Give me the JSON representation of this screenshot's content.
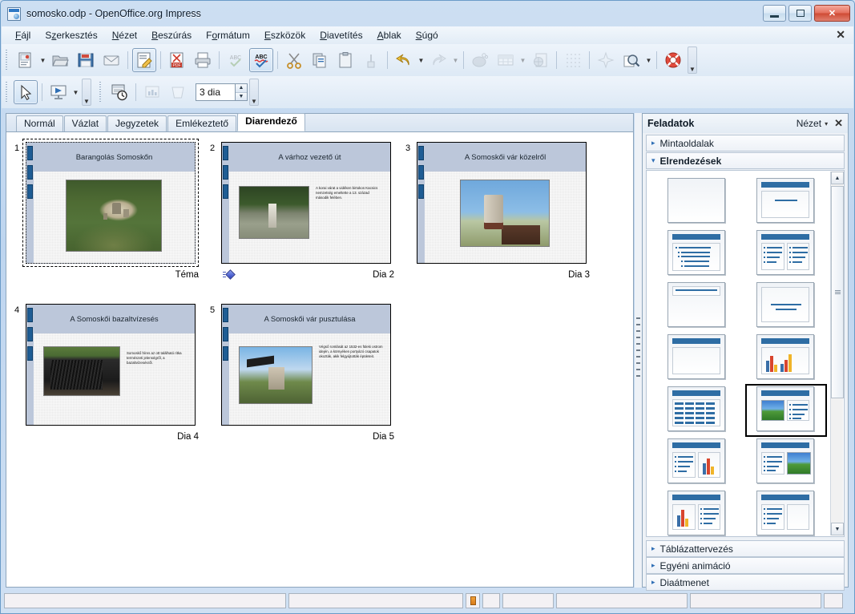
{
  "window": {
    "title": "somosko.odp - OpenOffice.org Impress",
    "app_icon": "impress-icon",
    "minimize_label": "Minimize",
    "maximize_label": "Maximize",
    "close_label": "✕"
  },
  "menubar": {
    "items": [
      {
        "label": "Fájl",
        "mnemonic": "F"
      },
      {
        "label": "Szerkesztés",
        "mnemonic": "z"
      },
      {
        "label": "Nézet",
        "mnemonic": "N"
      },
      {
        "label": "Beszúrás",
        "mnemonic": "B"
      },
      {
        "label": "Formátum",
        "mnemonic": "o"
      },
      {
        "label": "Eszközök",
        "mnemonic": "E"
      },
      {
        "label": "Diavetítés",
        "mnemonic": "D"
      },
      {
        "label": "Ablak",
        "mnemonic": "A"
      },
      {
        "label": "Súgó",
        "mnemonic": "S"
      }
    ],
    "close_document_label": "✕"
  },
  "toolbar_standard": {
    "buttons": [
      {
        "name": "new-document",
        "icon": "new-doc-icon",
        "enabled": true,
        "has_dropdown": true
      },
      {
        "name": "open-document",
        "icon": "open-folder-icon",
        "enabled": true
      },
      {
        "name": "save-document",
        "icon": "save-disk-icon",
        "enabled": true
      },
      {
        "name": "send-email",
        "icon": "envelope-icon",
        "enabled": true
      },
      {
        "name": "edit-file",
        "icon": "edit-pencil-icon",
        "enabled": true,
        "pressed": true
      },
      {
        "name": "export-pdf",
        "icon": "pdf-icon",
        "enabled": true
      },
      {
        "name": "print-file",
        "icon": "printer-icon",
        "enabled": true
      },
      {
        "name": "spellcheck",
        "icon": "abc-check-icon",
        "enabled": false
      },
      {
        "name": "autospellcheck",
        "icon": "abc-wave-icon",
        "enabled": true,
        "pressed": true
      },
      {
        "name": "cut",
        "icon": "scissors-icon",
        "enabled": true
      },
      {
        "name": "copy",
        "icon": "copy-icon",
        "enabled": true
      },
      {
        "name": "paste",
        "icon": "clipboard-icon",
        "enabled": true
      },
      {
        "name": "clone-formatting",
        "icon": "paintbrush-icon",
        "enabled": false
      },
      {
        "name": "undo",
        "icon": "undo-arrow-icon",
        "enabled": true,
        "has_dropdown": true
      },
      {
        "name": "redo",
        "icon": "redo-arrow-icon",
        "enabled": false,
        "has_dropdown": true
      },
      {
        "name": "chart",
        "icon": "chart-pie-icon",
        "enabled": false
      },
      {
        "name": "table",
        "icon": "table-grid-icon",
        "enabled": false,
        "has_dropdown": true
      },
      {
        "name": "hyperlink",
        "icon": "globe-page-icon",
        "enabled": false
      },
      {
        "name": "display-grid",
        "icon": "grid-dots-icon",
        "enabled": false
      },
      {
        "name": "show-draw-functions",
        "icon": "star-shape-icon",
        "enabled": false
      },
      {
        "name": "zoom",
        "icon": "magnifier-icon",
        "enabled": true,
        "has_dropdown": true
      },
      {
        "name": "help",
        "icon": "lifebuoy-help-icon",
        "enabled": true
      }
    ]
  },
  "toolbar_slideview": {
    "buttons": [
      {
        "name": "select-tool",
        "icon": "cursor-arrow-icon",
        "enabled": true,
        "pressed": true
      },
      {
        "name": "start-slideshow",
        "icon": "presentation-screen-icon",
        "enabled": true,
        "has_dropdown": true
      },
      {
        "name": "rehearse-timings",
        "icon": "clock-presentation-icon",
        "enabled": true
      },
      {
        "name": "show-slide",
        "icon": "show-slide-icon",
        "enabled": false
      },
      {
        "name": "hide-slide",
        "icon": "hide-slide-icon",
        "enabled": false
      }
    ],
    "slides_per_row": {
      "label": "3 dia",
      "value": "3 dia",
      "name": "slides-per-row-spinner"
    }
  },
  "view_tabs": {
    "items": [
      {
        "label": "Normál",
        "selected": false
      },
      {
        "label": "Vázlat",
        "selected": false
      },
      {
        "label": "Jegyzetek",
        "selected": false
      },
      {
        "label": "Emlékeztető",
        "selected": false
      },
      {
        "label": "Diarendező",
        "selected": true
      }
    ]
  },
  "slides": [
    {
      "number": "1",
      "title": "Barangolás Somoskőn",
      "caption": "Téma",
      "selected": true,
      "has_transition": false,
      "layout": "title-only-image",
      "body_text": "",
      "image": "ph-castle-aerial"
    },
    {
      "number": "2",
      "title": "A várhoz vezető út",
      "caption": "Dia 2",
      "selected": false,
      "has_transition": true,
      "layout": "image-left-text-right",
      "body_text": "A korai várat a vidéken birtokos Kacsics nemzetség emeltette a 13. század második felében.",
      "image": "ph-path"
    },
    {
      "number": "3",
      "title": "A Somoskői vár közelről",
      "caption": "Dia 3",
      "selected": false,
      "has_transition": false,
      "layout": "title-only-image",
      "body_text": "",
      "image": "ph-tower"
    },
    {
      "number": "4",
      "title": "A Somoskői bazaltvízesés",
      "caption": "Dia 4",
      "selected": false,
      "has_transition": false,
      "layout": "image-left-text-right",
      "body_text": "Somoskő híres az ott található ritka természeti jelenségről, a bazaltvízesésről.",
      "image": "ph-waterfall"
    },
    {
      "number": "5",
      "title": "A Somoskői vár pusztulása",
      "caption": "Dia 5",
      "selected": false,
      "has_transition": false,
      "layout": "image-left-text-right",
      "body_text": "Végső romlását az 1532-es füleki ostrom idején, a környéken portyázó csapatok okozták, akik felgyújtották épületeit.",
      "image": "ph-bell"
    }
  ],
  "task_panel": {
    "title": "Feladatok",
    "view_label": "Nézet",
    "view_caret": "▾",
    "close_label": "✕",
    "sections": [
      {
        "label": "Mintaoldalak",
        "expanded": false,
        "tri": "▸"
      },
      {
        "label": "Elrendezések",
        "expanded": true,
        "tri": "▾"
      },
      {
        "label": "Táblázattervezés",
        "expanded": false,
        "tri": "▸"
      },
      {
        "label": "Egyéni animáció",
        "expanded": false,
        "tri": "▸"
      },
      {
        "label": "Diaátmenet",
        "expanded": false,
        "tri": "▸"
      }
    ],
    "layouts": [
      {
        "name": "blank-slide",
        "kind": "blank",
        "selected": false
      },
      {
        "name": "title-content",
        "kind": "title-subtitle",
        "selected": false
      },
      {
        "name": "title-bullets",
        "kind": "title-bullets",
        "selected": false
      },
      {
        "name": "title-two-bullets",
        "kind": "title-two-bullets",
        "selected": false
      },
      {
        "name": "title-only",
        "kind": "title-only",
        "selected": false
      },
      {
        "name": "centered-text",
        "kind": "centered-text",
        "selected": false
      },
      {
        "name": "title-blank-content",
        "kind": "title-empty",
        "selected": false
      },
      {
        "name": "title-chart",
        "kind": "title-chart",
        "selected": false
      },
      {
        "name": "title-table",
        "kind": "title-table",
        "selected": false
      },
      {
        "name": "title-image-bullets",
        "kind": "title-image-bullets",
        "selected": true
      },
      {
        "name": "title-bullets-chart",
        "kind": "title-bullets-chart",
        "selected": false
      },
      {
        "name": "title-bullets-image",
        "kind": "title-bullets-image",
        "selected": false
      },
      {
        "name": "title-chart-bullets",
        "kind": "title-chart-bullets",
        "selected": false
      },
      {
        "name": "title-bullets-empty",
        "kind": "title-bullets-empty",
        "selected": false
      }
    ],
    "scrollbar": {
      "up": "▲",
      "down": "▼"
    }
  },
  "statusbar": {
    "fields": [
      "",
      "",
      "",
      "",
      "",
      ""
    ],
    "modified_icon": "document-modified-icon"
  },
  "colors": {
    "accent": "#2e6da4",
    "titlebar_text": "#0b1a2b",
    "slide_title_bg": "#bcc7da",
    "selection_border": "#000000"
  }
}
